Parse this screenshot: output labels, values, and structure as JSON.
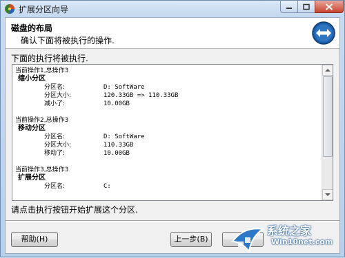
{
  "window": {
    "title": "扩展分区向导"
  },
  "header": {
    "title": "磁盘的布局",
    "subtitle": "确认下面将被执行的操作."
  },
  "log_section": {
    "label": "下面的执行将被执行.",
    "operations": [
      {
        "step": "当前操作1,总操作3",
        "name": "缩小分区",
        "fields": [
          {
            "key": "分区名:",
            "value": "D: SoftWare"
          },
          {
            "key": "分区大小:",
            "value": "120.33GB => 110.33GB"
          },
          {
            "key": "减小了:",
            "value": "10.00GB"
          }
        ]
      },
      {
        "step": "当前操作2,总操作3",
        "name": "移动分区",
        "fields": [
          {
            "key": "分区名:",
            "value": "D: SoftWare"
          },
          {
            "key": "分区大小:",
            "value": "110.33GB"
          },
          {
            "key": "移动了:",
            "value": "10.00GB"
          }
        ]
      },
      {
        "step": "当前操作3,总操作3",
        "name": "扩展分区",
        "fields": [
          {
            "key": "分区名:",
            "value": "C: "
          }
        ]
      }
    ]
  },
  "instruction": "请点击执行按钮开始扩展这个分区.",
  "buttons": {
    "help": "帮助(H)",
    "back": "上一步(B)",
    "next": ""
  },
  "watermark": {
    "brand": "系统之家",
    "url": "Win10net.com"
  },
  "icons": {
    "app": "partition-wizard-icon",
    "header": "expand-arrows-icon"
  },
  "colors": {
    "title_bar": "#c4d8ef",
    "close_button": "#c9452f",
    "header_icon": "#1f5fa8"
  }
}
